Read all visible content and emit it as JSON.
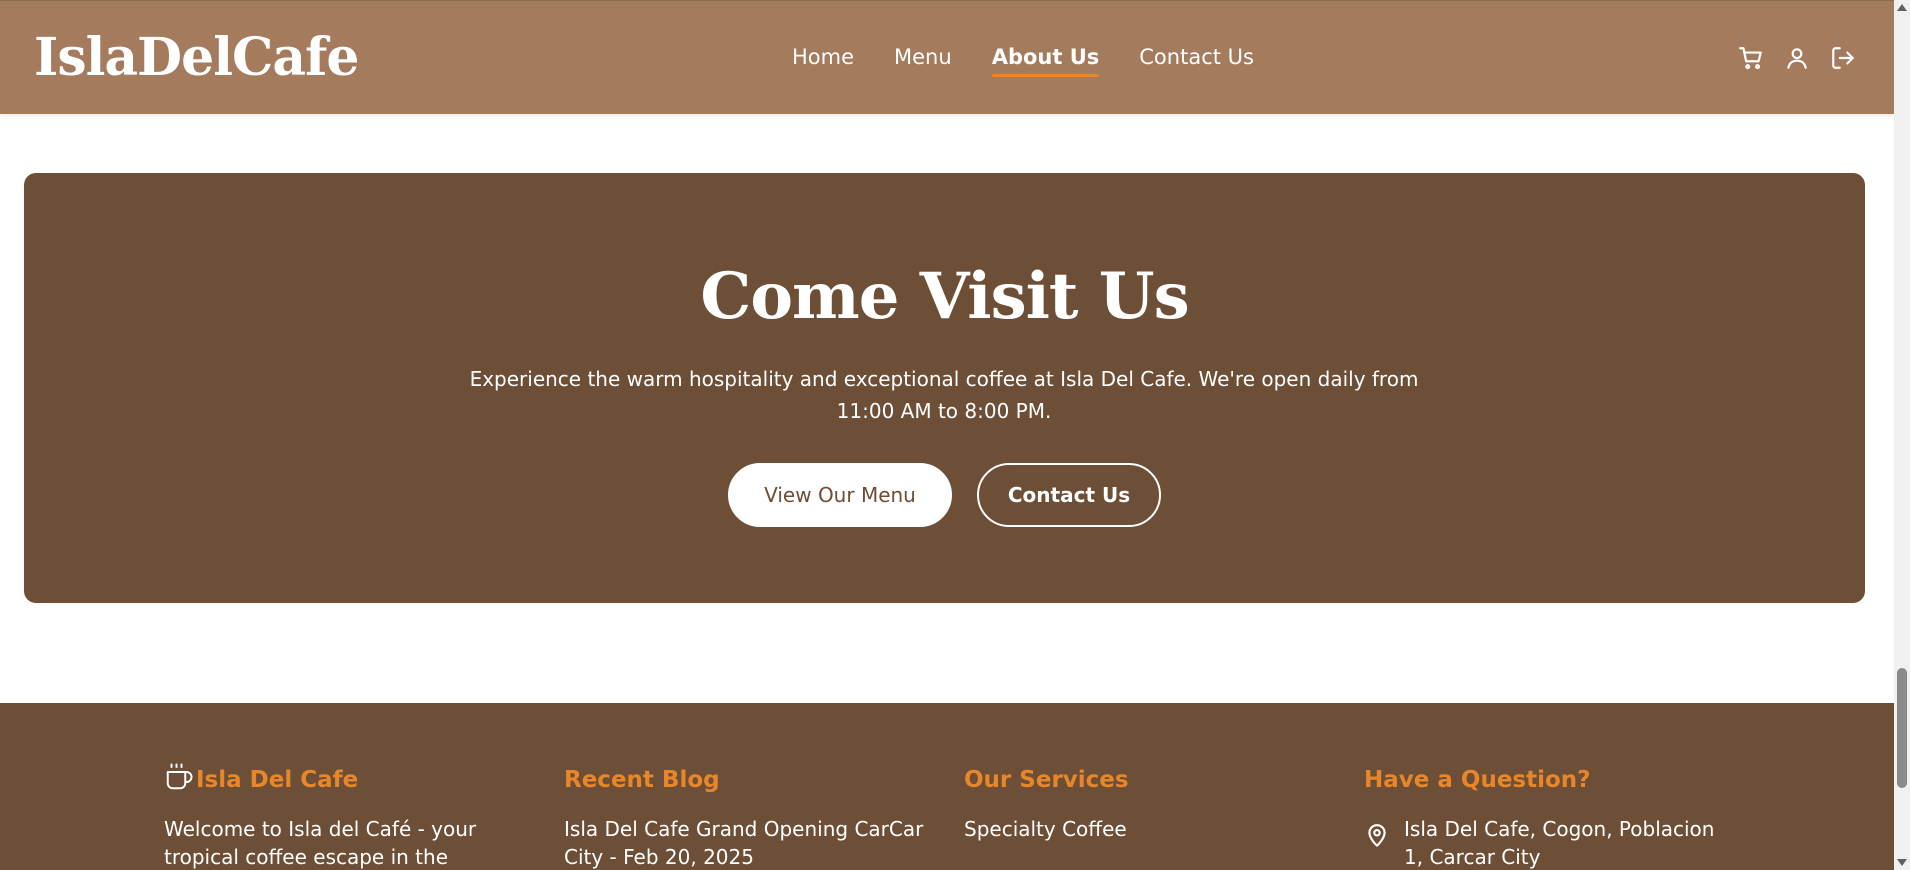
{
  "header": {
    "logo": "IslaDelCafe",
    "nav": [
      "Home",
      "Menu",
      "About Us",
      "Contact Us"
    ],
    "active_nav": "About Us",
    "icons": [
      "cart-icon",
      "user-icon",
      "logout-icon"
    ]
  },
  "visit": {
    "title": "Come Visit Us",
    "description": "Experience the warm hospitality and exceptional coffee at Isla Del Cafe. We're open daily from 11:00 AM to 8:00 PM.",
    "primary_button": "View Our Menu",
    "secondary_button": "Contact Us"
  },
  "footer": {
    "brand": {
      "title": "Isla Del Cafe",
      "text": "Welcome to Isla del Café - your tropical coffee escape in the Heritage"
    },
    "blog": {
      "title": "Recent Blog",
      "item": "Isla Del Cafe Grand Opening CarCar City - Feb 20, 2025"
    },
    "services": {
      "title": "Our Services",
      "item": "Specialty Coffee"
    },
    "question": {
      "title": "Have a Question?",
      "address": "Isla Del Cafe, Cogon, Poblacion 1, Carcar City"
    }
  },
  "colors": {
    "header_bg": "#a57b5d",
    "section_bg": "#6d4e36",
    "accent": "#e8862a"
  }
}
